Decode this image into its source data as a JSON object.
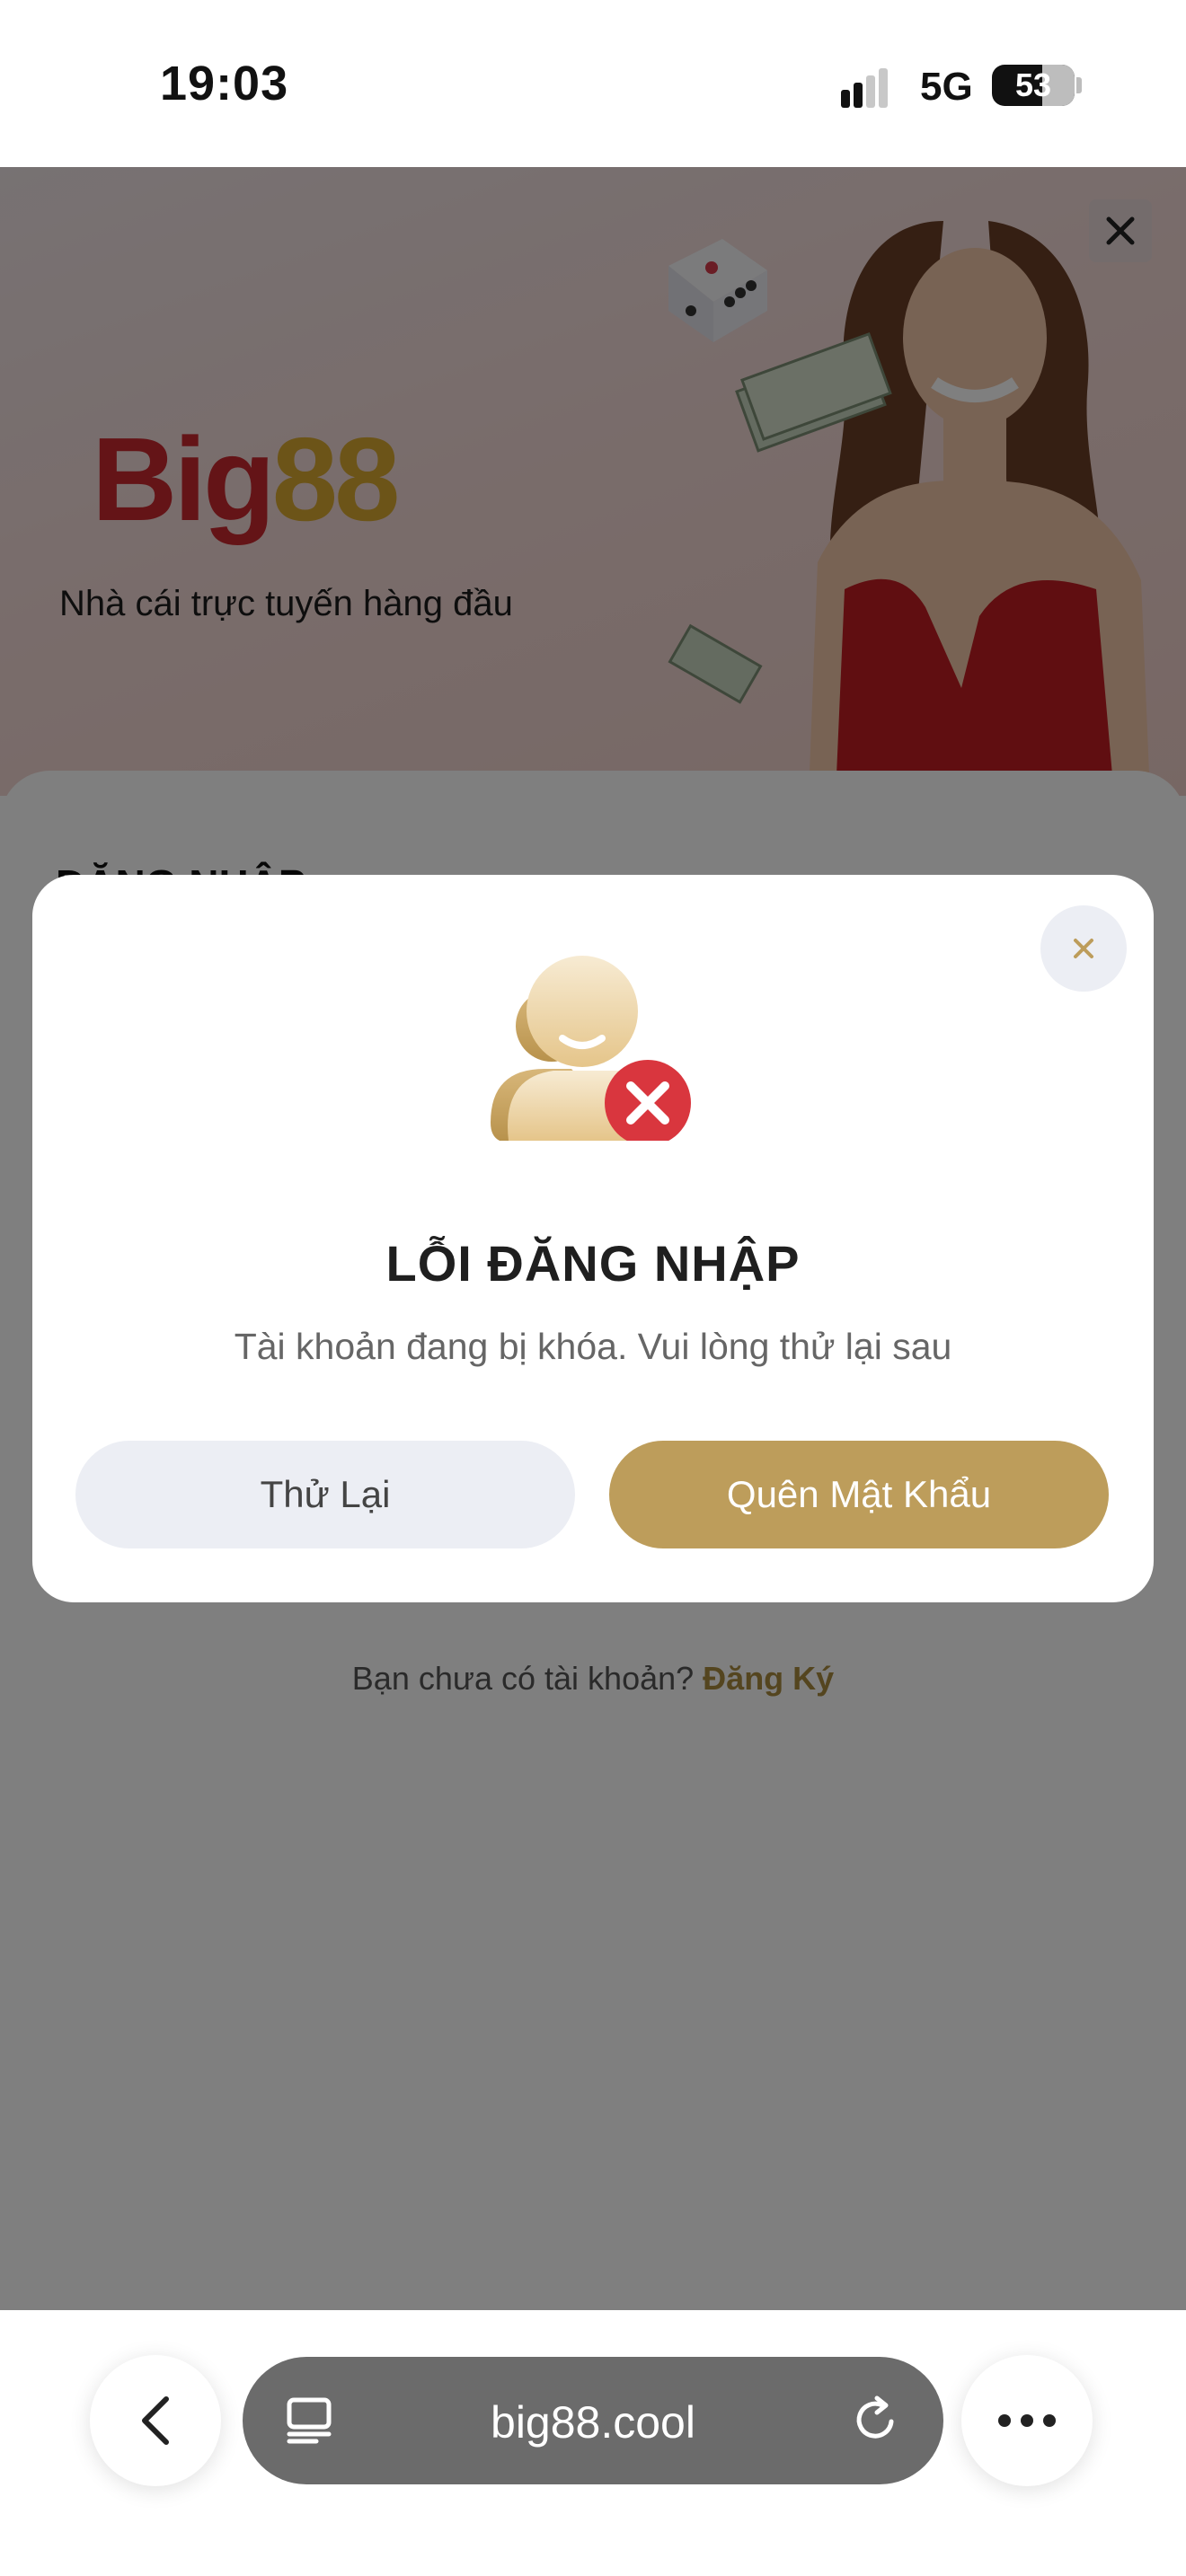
{
  "status_bar": {
    "time": "19:03",
    "network": "5G",
    "battery": "53"
  },
  "hero": {
    "logo_part1": "Big",
    "logo_part2": "88",
    "tagline": "Nhà cái trực tuyến hàng đầu"
  },
  "sheet": {
    "title": "ĐĂNG NHẬP",
    "register_prompt": "Bạn chưa có tài khoản?",
    "register_link": "Đăng Ký"
  },
  "modal": {
    "title": "LỖI ĐĂNG NHẬP",
    "message": "Tài khoản đang bị khóa. Vui lòng thử lại sau",
    "retry_label": "Thử Lại",
    "forgot_label": "Quên Mật Khẩu"
  },
  "browser": {
    "url": "big88.cool"
  },
  "colors": {
    "accent_gold": "#bd9d5b",
    "error_red": "#d9363e",
    "logo_red": "#c8282f",
    "logo_gold": "#d8a830"
  },
  "icons": [
    "close-icon",
    "user-error-icon",
    "back-icon",
    "tabs-icon",
    "reload-icon",
    "more-icon"
  ]
}
